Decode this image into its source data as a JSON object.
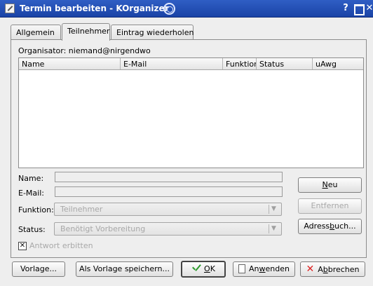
{
  "window": {
    "title": "Termin bearbeiten - KOrganizer",
    "help_label": "?"
  },
  "tabs": [
    {
      "label": "Allgemein",
      "active": false
    },
    {
      "label": "Teilnehmer",
      "active": true
    },
    {
      "label": "Eintrag wiederholen",
      "active": false
    }
  ],
  "organizer": "Organisator: niemand@nirgendwo",
  "attendee_list": {
    "columns": [
      "Name",
      "E-Mail",
      "Funktion",
      "Status",
      "uAwg"
    ],
    "rows": []
  },
  "form": {
    "name_label": "Name:",
    "name_value": "",
    "email_label": "E-Mail:",
    "email_value": "",
    "role_label": "Funktion:",
    "role_value": "Teilnehmer",
    "status_label": "Status:",
    "status_value": "Benötigt Vorbereitung",
    "rsvp_label": "Antwort erbitten",
    "rsvp_checked": true
  },
  "side_buttons": {
    "new": {
      "prefix": "",
      "underline": "N",
      "suffix": "eu"
    },
    "remove": "Entfernen",
    "addressbook": {
      "prefix": "Adress",
      "underline": "b",
      "suffix": "uch..."
    }
  },
  "bottom_buttons": {
    "template": "Vorlage...",
    "save_as_template": "Als Vorlage speichern...",
    "ok": {
      "underline": "O",
      "suffix": "K"
    },
    "apply": {
      "prefix": "An",
      "underline": "w",
      "suffix": "enden"
    },
    "cancel": {
      "prefix": "A",
      "underline": "b",
      "suffix": "brechen"
    }
  },
  "colors": {
    "titlebar": "#2350b5",
    "ok_check": "#2b9a2b",
    "cancel_x": "#d22222"
  }
}
